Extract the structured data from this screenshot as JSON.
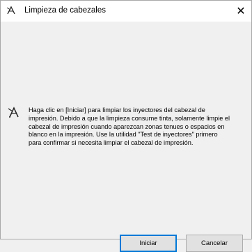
{
  "window": {
    "title": "Limpieza de cabezales",
    "title_icon": "print-head-cleaning-icon",
    "close_label": "✕"
  },
  "dialog": {
    "icon": "print-head-cleaning-icon",
    "message": "Haga clic en [Iniciar] para limpiar los inyectores del cabezal de\nimpresión. Debido a que la limpieza consume tinta, solamente limpie el\ncabezal de impresión cuando aparezcan zonas tenues o espacios en\nblanco en la impresión. Use la utilidad \"Test de inyectores\" primero\npara confirmar si necesita limpiar el cabezal de impresión."
  },
  "buttons": {
    "start_label": "Iniciar",
    "cancel_label": "Cancelar"
  },
  "colors": {
    "focus_border": "#0078d7",
    "button_face": "#e1e1e1",
    "window_bg": "#f0f0f0"
  }
}
